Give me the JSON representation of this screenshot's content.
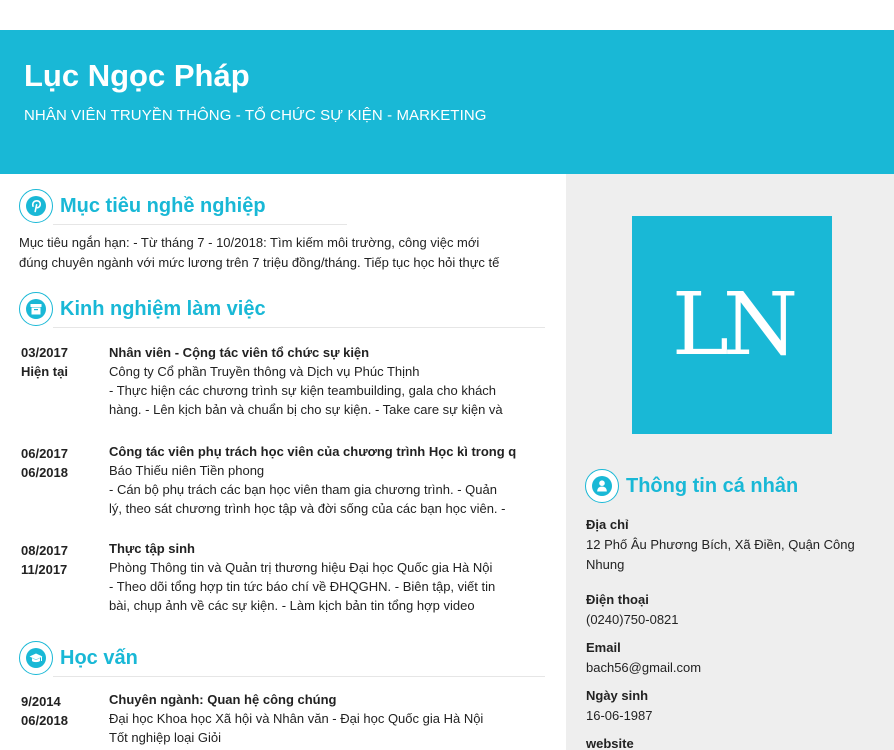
{
  "header": {
    "name": "Lục Ngọc Pháp",
    "role": "NHÂN VIÊN TRUYỀN THÔNG - TỔ CHỨC SỰ KIỆN - MARKETING"
  },
  "objective": {
    "title": "Mục tiêu nghề nghiệp",
    "icon": "pinterest-icon",
    "lines": [
      "Mục tiêu ngắn hạn: - Từ tháng 7 - 10/2018: Tìm kiếm môi trường, công việc mới",
      "đúng chuyên ngành với mức lương trên 7 triệu đồng/tháng. Tiếp tục học hỏi thực tế"
    ]
  },
  "experience": {
    "title": "Kinh nghiệm làm việc",
    "icon": "archive-box-icon",
    "items": [
      {
        "start": "03/2017",
        "end": "Hiện tại",
        "position": "Nhân viên - Cộng tác viên tổ chức sự kiện",
        "company": "Công ty Cổ phần Truyền thông và Dịch vụ Phúc Thịnh",
        "desc": [
          "- Thực hiện các chương trình sự kiện teambuilding, gala cho khách",
          "hàng. - Lên kịch bản và chuẩn bị cho sự kiện. - Take care sự kiện và"
        ]
      },
      {
        "start": "06/2017",
        "end": "06/2018",
        "position": "Công tác viên phụ trách học viên của chương trình Học kì trong q",
        "company": "Báo Thiếu niên Tiền phong",
        "desc": [
          "- Cán bộ phụ trách các bạn học viên tham gia chương trình. - Quản",
          "lý, theo sát chương trình học tập và đời sống của các bạn học viên. -"
        ]
      },
      {
        "start": "08/2017",
        "end": "11/2017",
        "position": "Thực tập sinh",
        "company": "Phòng Thông tin và Quản trị thương hiệu Đại học Quốc gia Hà Nội",
        "desc": [
          "- Theo dõi tổng hợp tin tức báo chí về ĐHQGHN. - Biên tập, viết tin",
          "bài, chụp ảnh về các sự kiện. - Làm kịch bản tin tổng hợp video"
        ]
      }
    ]
  },
  "education": {
    "title": "Học vấn",
    "icon": "graduation-cap-icon",
    "items": [
      {
        "start": "9/2014",
        "end": "06/2018",
        "major": "Chuyên ngành: Quan hệ công chúng",
        "school": "Đại học Khoa học Xã hội và Nhân văn - Đại học Quốc gia Hà Nội",
        "grade": "Tốt nghiệp loại Giỏi"
      }
    ]
  },
  "avatar": {
    "initials": "LN",
    "color": "#19b8d6"
  },
  "personal": {
    "title": "Thông tin cá nhân",
    "icon": "user-icon",
    "address_label": "Địa chỉ",
    "address_lines": [
      "12 Phố Âu Phương Bích, Xã Điền, Quận Công",
      "Nhung"
    ],
    "phone_label": "Điện thoại",
    "phone": "(0240)750-0821",
    "email_label": "Email",
    "email": "bach56@gmail.com",
    "dob_label": "Ngày sinh",
    "dob": "16-06-1987",
    "website_label": "website"
  },
  "colors": {
    "accent": "#19b8d6",
    "sidebar_bg": "#eeeeee"
  }
}
